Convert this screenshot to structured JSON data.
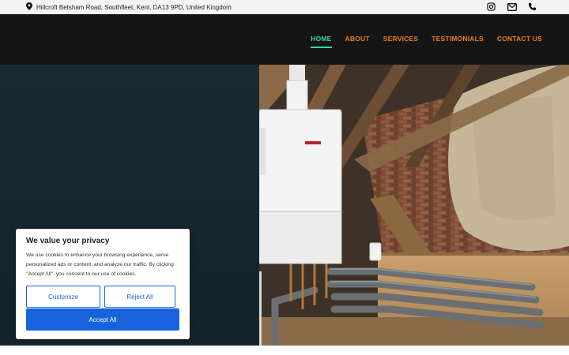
{
  "topbar": {
    "address": "Hillcroft Betsham Road, Southfleet, Kent, DA13 9PD, United Kingdom",
    "icons": [
      "location-pin-icon",
      "instagram-icon",
      "mail-icon",
      "phone-icon"
    ]
  },
  "nav": {
    "items": [
      {
        "label": "HOME",
        "active": true
      },
      {
        "label": "ABOUT",
        "active": false
      },
      {
        "label": "SERVICES",
        "active": false
      },
      {
        "label": "TESTIMONIALS",
        "active": false
      },
      {
        "label": "CONTACT US",
        "active": false
      }
    ]
  },
  "hero": {
    "image_alt": "Wall-mounted boiler installed in a loft with copper pipework"
  },
  "cookie": {
    "title": "We value your privacy",
    "body": "We use cookies to enhance your browsing experience, serve personalized ads or content, and analyze our traffic. By clicking \"Accept All\", you consent to our use of cookies.",
    "customize_label": "Customize",
    "reject_label": "Reject All",
    "accept_label": "Accept All"
  },
  "colors": {
    "accent_nav": "#f07d1e",
    "active_nav": "#3dd6a0",
    "consent_blue": "#1863dc",
    "header_bg": "#151515",
    "hero_bg": "#182a32"
  }
}
